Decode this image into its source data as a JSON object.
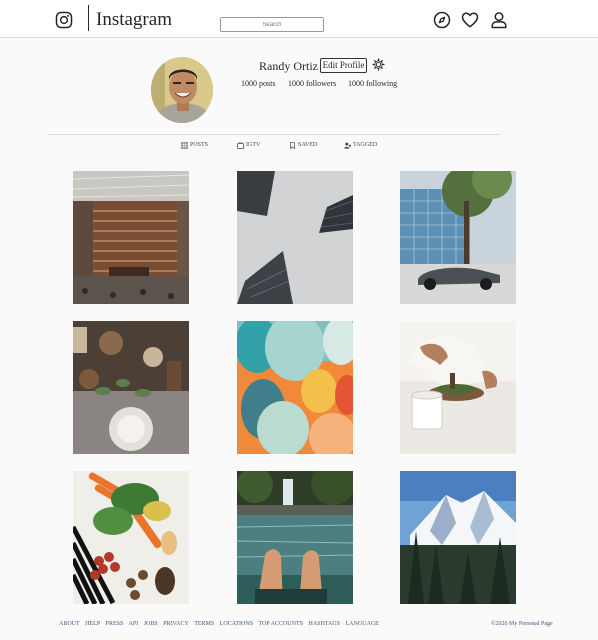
{
  "header": {
    "logo_text": "Instagram",
    "search_placeholder": "Search",
    "icons": [
      "instagram-camera-icon",
      "compass-icon",
      "heart-icon",
      "profile-icon"
    ]
  },
  "profile": {
    "username": "Randy Ortiz",
    "edit_label": "Edit Profile",
    "posts": "1000 posts",
    "followers": "1000 followers",
    "following": "1000 following"
  },
  "tabs": [
    {
      "label": "POSTS",
      "icon": "grid-icon"
    },
    {
      "label": "IGTV",
      "icon": "igtv-icon"
    },
    {
      "label": "SAVED",
      "icon": "bookmark-icon"
    },
    {
      "label": "TAGGED",
      "icon": "tagged-icon"
    }
  ],
  "grid": [
    "library-bookshelf-photo",
    "skyscraper-fog-photo",
    "car-street-photo",
    "dinner-table-photo",
    "balloons-photo",
    "coffee-brewing-photo",
    "vegetables-photo",
    "waterfall-feet-photo",
    "snowy-mountain-photo"
  ],
  "footer": {
    "links": [
      "ABOUT",
      "HELP",
      "PRESS",
      "API",
      "JOBS",
      "PRIVACY",
      "TERMS",
      "LOCATIONS",
      "TOP ACCOUNTS",
      "HASHTAGS",
      "LANGUAGE"
    ],
    "copyright": "©2020 My Personal Page"
  },
  "colors": {
    "page_background": "#fafafa",
    "header_background": "#ffffff",
    "border": "#dbdbdb",
    "footer_link": "#3b5a88"
  }
}
